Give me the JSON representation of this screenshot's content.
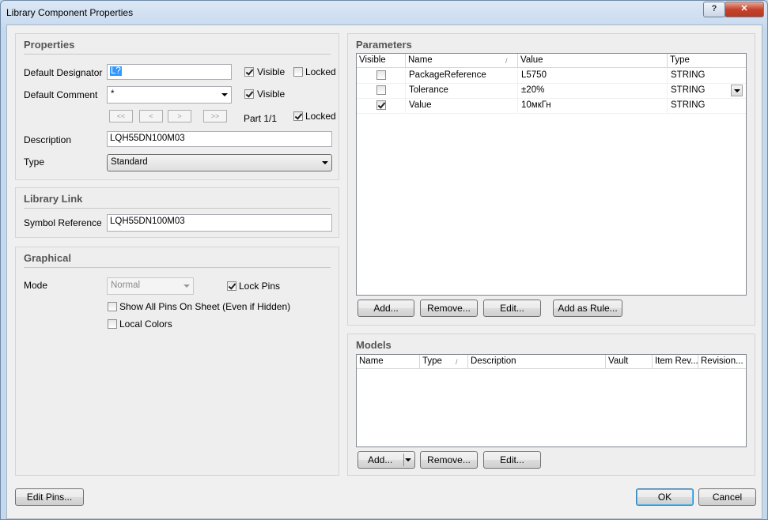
{
  "window": {
    "title": "Library Component Properties",
    "help_label": "?",
    "close_label": "✕"
  },
  "properties": {
    "title": "Properties",
    "default_designator_label": "Default Designator",
    "default_designator_value": "L?",
    "default_comment_label": "Default Comment",
    "default_comment_value": "*",
    "visible_label": "Visible",
    "locked_label": "Locked",
    "nav": [
      "<<",
      "<",
      ">",
      ">>"
    ],
    "part_label": "Part 1/1",
    "description_label": "Description",
    "description_value": "LQH55DN100M03",
    "type_label": "Type",
    "type_value": "Standard"
  },
  "library_link": {
    "title": "Library Link",
    "symbol_reference_label": "Symbol Reference",
    "symbol_reference_value": "LQH55DN100M03"
  },
  "graphical": {
    "title": "Graphical",
    "mode_label": "Mode",
    "mode_value": "Normal",
    "lock_pins_label": "Lock Pins",
    "show_all_pins_label": "Show All Pins On Sheet (Even if Hidden)",
    "local_colors_label": "Local Colors"
  },
  "parameters": {
    "title": "Parameters",
    "columns": [
      "Visible",
      "Name",
      "Value",
      "Type"
    ],
    "rows": [
      {
        "visible": false,
        "name": "PackageReference",
        "value": "L5750",
        "type": "STRING"
      },
      {
        "visible": false,
        "name": "Tolerance",
        "value": "±20%",
        "type": "STRING"
      },
      {
        "visible": true,
        "name": "Value",
        "value": "10мкГн",
        "type": "STRING"
      }
    ],
    "buttons": {
      "add": "Add...",
      "remove": "Remove...",
      "edit": "Edit...",
      "add_as_rule": "Add as Rule..."
    }
  },
  "models": {
    "title": "Models",
    "columns": [
      "Name",
      "Type",
      "Description",
      "Vault",
      "Item Rev...",
      "Revision..."
    ],
    "buttons": {
      "add": "Add...",
      "remove": "Remove...",
      "edit": "Edit..."
    }
  },
  "footer": {
    "edit_pins": "Edit Pins...",
    "ok": "OK",
    "cancel": "Cancel"
  }
}
